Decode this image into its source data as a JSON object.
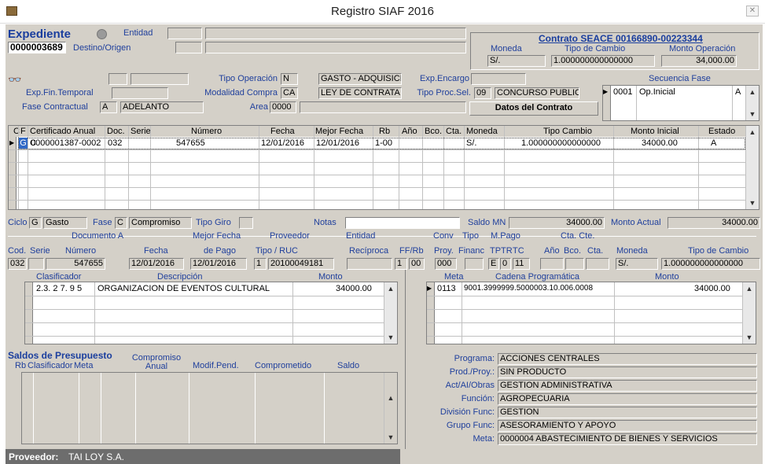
{
  "window": {
    "title": "Registro SIAF 2016",
    "close_label": "✕"
  },
  "expediente": {
    "label": "Expediente",
    "number": "0000003689",
    "entidad_label": "Entidad",
    "destino_label": "Destino/Origen"
  },
  "contrato": {
    "title": "Contrato SEACE 00166890-00223344",
    "moneda_label": "Moneda",
    "moneda": "S/.",
    "tipo_cambio_label": "Tipo de Cambio",
    "tipo_cambio": "1.000000000000000",
    "monto_label": "Monto Operación",
    "monto": "34,000.00",
    "datos_btn": "Datos del Contrato"
  },
  "operacion": {
    "tipo_operacion_label": "Tipo Operación",
    "tipo_operacion_code": "N",
    "tipo_operacion": "GASTO - ADQUISICI",
    "exp_encargo_label": "Exp.Encargo",
    "exp_fin_temporal_label": "Exp.Fin.Temporal",
    "modalidad_label": "Modalidad Compra",
    "modalidad_code": "CA",
    "modalidad": "LEY DE CONTRATA",
    "tipo_proc_label": "Tipo Proc.Sel.",
    "tipo_proc_code": "09",
    "tipo_proc": "CONCURSO PUBLIC",
    "fase_contractual_label": "Fase Contractual",
    "fase_contractual_code": "A",
    "fase_contractual": "ADELANTO",
    "area_label": "Area",
    "area": "0000"
  },
  "secuencia": {
    "title": "Secuencia Fase",
    "code": "0001",
    "desc": "Op.Inicial",
    "state": "A"
  },
  "main_grid": {
    "headers": [
      "C",
      "F",
      "Certificado Anual",
      "Doc.",
      "Serie",
      "Número",
      "Fecha",
      "Mejor Fecha",
      "Rb",
      "Año",
      "Bco.",
      "Cta.",
      "Moneda",
      "Tipo Cambio",
      "Monto Inicial",
      "Estado"
    ],
    "row": {
      "c": "G",
      "f": "C",
      "cert": "0000001387-0002",
      "doc": "032",
      "serie": "",
      "numero": "547655",
      "fecha": "12/01/2016",
      "mejor_fecha": "12/01/2016",
      "rb": "1-00",
      "ano": "",
      "bco": "",
      "cta": "",
      "moneda": "S/.",
      "tipo_cambio": "1.000000000000000",
      "monto": "34000.00",
      "estado": "A"
    }
  },
  "ciclo": {
    "ciclo_label": "Ciclo",
    "ciclo_code": "G",
    "ciclo": "Gasto",
    "fase_label": "Fase",
    "fase_code": "C",
    "fase": "Compromiso",
    "tipo_giro_label": "Tipo Giro",
    "notas_label": "Notas",
    "saldo_label": "Saldo MN",
    "saldo": "34000.00",
    "monto_actual_label": "Monto Actual",
    "monto_actual": "34000.00"
  },
  "doc": {
    "doc_a_label": "Documento A",
    "mejor_fecha_label": "Mejor Fecha",
    "proveedor_label": "Proveedor",
    "entidad_label": "Entidad",
    "conv_label": "Conv",
    "tipo_label": "Tipo",
    "mpago_label": "M.Pago",
    "cta_cte_label": "Cta. Cte.",
    "cod_label": "Cod.",
    "serie_label": "Serie",
    "numero_label": "Número",
    "fecha_label": "Fecha",
    "de_pago_label": "de Pago",
    "tipo_ruc_label": "Tipo / RUC",
    "reciproca_label": "Recíproca",
    "ffrb_label": "FF/Rb",
    "proy_label": "Proy.",
    "financ_label": "Financ",
    "tp_label": "TP",
    "tr_label": "TR",
    "tc_label": "TC",
    "ano_label": "Año",
    "bco_label": "Bco.",
    "cta_label": "Cta.",
    "moneda_label": "Moneda",
    "tipo_cambio_label": "Tipo de Cambio",
    "cod": "032",
    "numero": "547655",
    "fecha": "12/01/2016",
    "de_pago": "12/01/2016",
    "tipo": "1",
    "ruc": "20100049181",
    "ff": "1",
    "rb": "00",
    "proy": "000",
    "tp": "E",
    "tr": "0",
    "tc": "11",
    "moneda": "S/.",
    "tipo_cambio": "1.000000000000000"
  },
  "clasificador": {
    "h1": "Clasificador",
    "h2": "Descripción",
    "h3": "Monto",
    "code": "2.3. 2 7. 9 5",
    "desc": "ORGANIZACION DE EVENTOS CULTURAL",
    "monto": "34000.00"
  },
  "meta": {
    "h1": "Meta",
    "h2": "Cadena Programática",
    "h3": "Monto",
    "code": "0113",
    "cadena": "9001.3999999.5000003.10.006.0008",
    "monto": "34000.00"
  },
  "saldos": {
    "title": "Saldos de Presupuesto",
    "headers": [
      "Rb",
      "Clasificador",
      "Meta",
      "Compromiso Anual",
      "Modif.Pend.",
      "Comprometido",
      "Saldo"
    ]
  },
  "programa": {
    "rows": [
      {
        "label": "Programa:",
        "value": "ACCIONES CENTRALES"
      },
      {
        "label": "Prod./Proy.:",
        "value": "SIN PRODUCTO"
      },
      {
        "label": "Act/AI/Obras",
        "value": "GESTION ADMINISTRATIVA"
      },
      {
        "label": "Función:",
        "value": "AGROPECUARIA"
      },
      {
        "label": "División Func:",
        "value": "GESTION"
      },
      {
        "label": "Grupo Func:",
        "value": "ASESORAMIENTO Y APOYO"
      },
      {
        "label": "Meta:",
        "value": "0000004  ABASTECIMIENTO DE BIENES Y SERVICIOS"
      }
    ]
  },
  "proveedor_footer": {
    "label": "Proveedor:",
    "value": "TAI LOY S.A."
  }
}
